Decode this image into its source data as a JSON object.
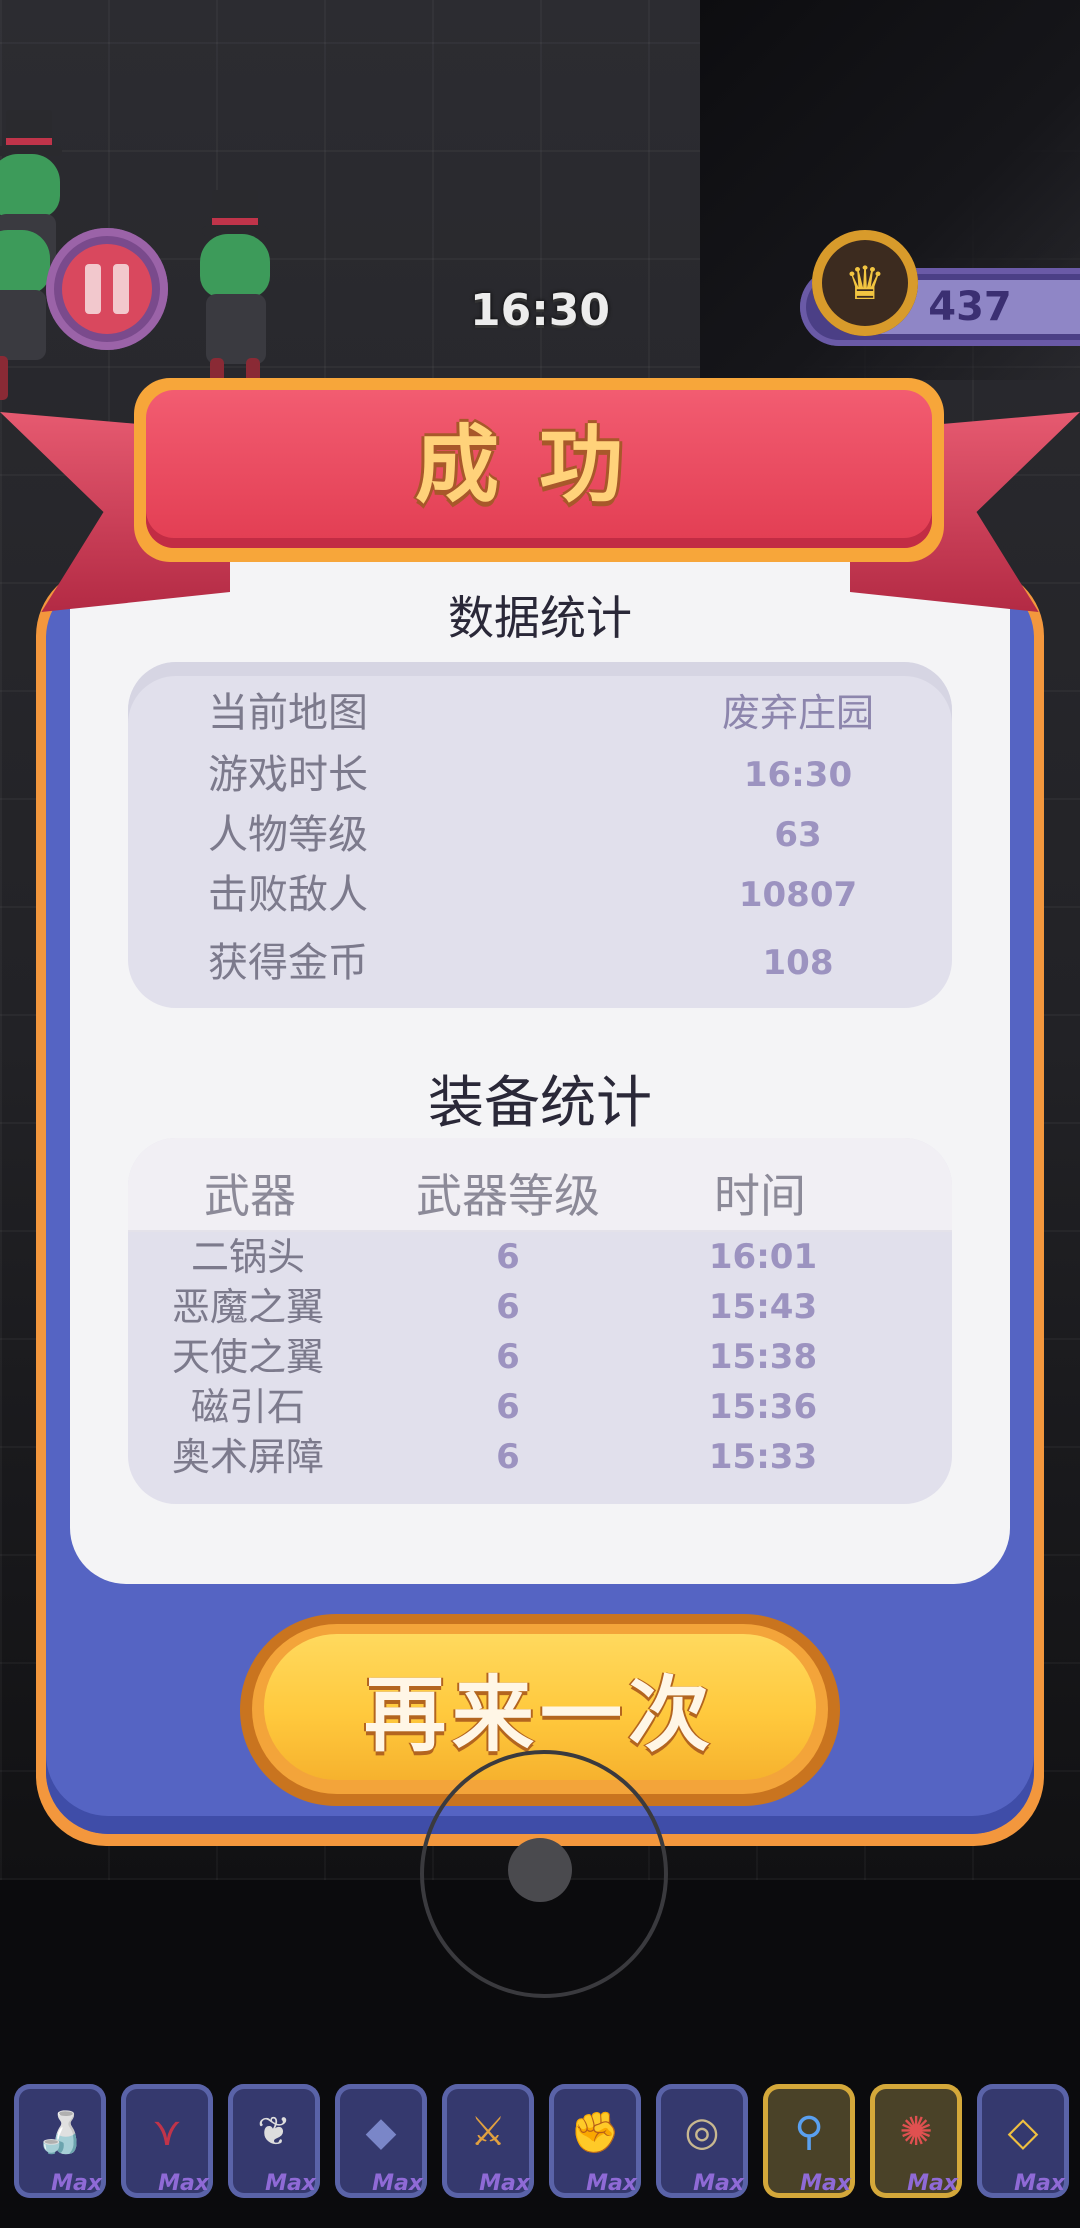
{
  "hud": {
    "timer": "16:30",
    "coins": "437",
    "pause_icon": "pause-icon",
    "coin_icon": "crown-coin-icon"
  },
  "dialog": {
    "title": "成功",
    "stats_title": "数据统计",
    "stats": [
      {
        "label": "当前地图",
        "value": "废弃庄园"
      },
      {
        "label": "游戏时长",
        "value": "16:30"
      },
      {
        "label": "人物等级",
        "value": "63"
      },
      {
        "label": "击败敌人",
        "value": "10807"
      },
      {
        "label": "获得金币",
        "value": "108"
      }
    ],
    "equipment_title": "装备统计",
    "equipment_headers": {
      "weapon": "武器",
      "level": "武器等级",
      "time": "时间"
    },
    "equipment": [
      {
        "name": "二锅头",
        "level": "6",
        "time": "16:01"
      },
      {
        "name": "恶魔之翼",
        "level": "6",
        "time": "15:43"
      },
      {
        "name": "天使之翼",
        "level": "6",
        "time": "15:38"
      },
      {
        "name": "磁引石",
        "level": "6",
        "time": "15:36"
      },
      {
        "name": "奥术屏障",
        "level": "6",
        "time": "15:33"
      }
    ],
    "retry_label": "再来一次"
  },
  "equipment_bar": [
    {
      "icon": "bottle-icon",
      "badge": "Max",
      "highlight": false
    },
    {
      "icon": "demon-wings-icon",
      "badge": "Max",
      "highlight": false
    },
    {
      "icon": "angel-wings-icon",
      "badge": "Max",
      "highlight": false
    },
    {
      "icon": "magnet-stone-icon",
      "badge": "Max",
      "highlight": false
    },
    {
      "icon": "axe-icon",
      "badge": "Max",
      "highlight": false
    },
    {
      "icon": "gauntlet-icon",
      "badge": "Max",
      "highlight": false
    },
    {
      "icon": "disc-blade-icon",
      "badge": "Max",
      "highlight": false
    },
    {
      "icon": "magic-wand-icon",
      "badge": "Max",
      "highlight": true
    },
    {
      "icon": "dragon-icon",
      "badge": "Max",
      "highlight": true
    },
    {
      "icon": "gem-icon",
      "badge": "Max",
      "highlight": false
    }
  ],
  "colors": {
    "ribbon": "#e23d52",
    "panel_blue": "#5564c3",
    "frame_orange": "#f3973d",
    "button_yellow": "#ffc93d",
    "value_purple": "#9c93c0"
  }
}
